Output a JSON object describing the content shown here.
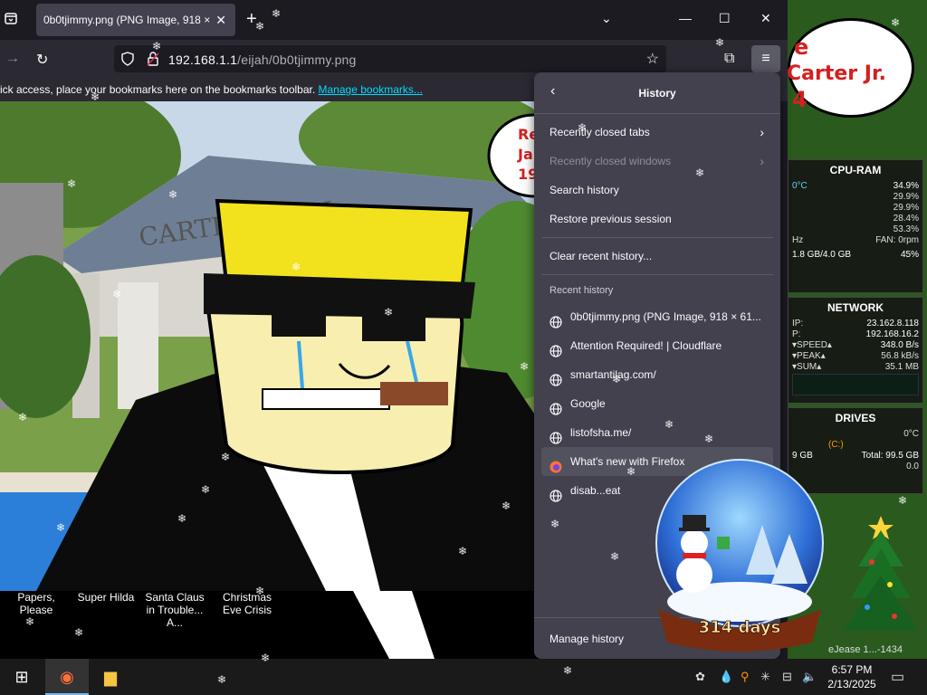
{
  "tab": {
    "title": "0b0tjimmy.png (PNG Image, 918 ×",
    "close_glyph": "✕",
    "new_glyph": "+"
  },
  "window_controls": {
    "list_tabs": "⌄",
    "minimize": "—",
    "maximize": "☐",
    "close": "✕"
  },
  "navbar": {
    "forward": "→",
    "reload": "↻",
    "url_host": "192.168.1.1",
    "url_path": "/eijah/0b0tjimmy.png",
    "bookmark_star": "☆",
    "extensions": "⧉",
    "menu": "≡"
  },
  "bookmarks_bar": {
    "text": "ick access, place your bookmarks here on the bookmarks toolbar.",
    "link": "Manage bookmarks..."
  },
  "image_labels": [
    {
      "text": "Papers, Please"
    },
    {
      "text": "Super Hilda"
    },
    {
      "text": "Santa Claus in Trouble... A..."
    },
    {
      "text": "Christmas Eve Crisis"
    }
  ],
  "image_text": {
    "sign": "CARTER   NTIAL",
    "bubble_partial_lines": [
      "Re",
      "Ja",
      "19"
    ]
  },
  "history_panel": {
    "back": "‹",
    "title": "History",
    "actions": [
      {
        "label": "Recently closed tabs",
        "arrow": "›",
        "disabled": false
      },
      {
        "label": "Recently closed windows",
        "arrow": "›",
        "disabled": true
      },
      {
        "label": "Search history",
        "arrow": "",
        "disabled": false
      },
      {
        "label": "Restore previous session",
        "arrow": "",
        "disabled": false
      }
    ],
    "clear": "Clear recent history...",
    "recent_header": "Recent history",
    "recent": [
      {
        "label": "0b0tjimmy.png (PNG Image, 918 × 61...",
        "icon": "globe-icon"
      },
      {
        "label": "Attention Required! | Cloudflare",
        "icon": "globe-icon"
      },
      {
        "label": "smartantilag.com/",
        "icon": "globe-icon"
      },
      {
        "label": "Google",
        "icon": "globe-icon"
      },
      {
        "label": "listofsha.me/",
        "icon": "globe-icon"
      },
      {
        "label": "What's new with Firefox",
        "icon": "firefox-icon"
      },
      {
        "label": "disab...eat",
        "icon": "globe-icon"
      }
    ],
    "manage": "Manage history"
  },
  "desktop": {
    "bubble_lines": [
      "e",
      "Carter Jr.",
      "4"
    ]
  },
  "gadgets": {
    "cpu": {
      "title": "CPU-RAM",
      "temp": "0°C",
      "total": "34.9%",
      "cores": [
        "29.9%",
        "29.9%",
        "28.4%",
        "53.3%"
      ],
      "freq_label": "Hz",
      "fan_label": "FAN: 0rpm",
      "ram": "1.8 GB/4.0 GB",
      "ram_pct": "45%"
    },
    "network": {
      "title": "NETWORK",
      "ip_label": "IP:",
      "ip": "23.162.8.118",
      "lan_label": "P:",
      "lan": "192.168.16.2",
      "speed_label": "▾SPEED▴",
      "speed": "348.0 B/s",
      "peak_label": "▾PEAK▴",
      "peak": "56.8 kB/s",
      "sum_label": "▾SUM▴",
      "sum": "35.1 MB"
    },
    "drives": {
      "title": "DRIVES",
      "temp": "0°C",
      "drive": "(C:)",
      "used": "9 GB",
      "total": "Total: 99.5 GB",
      "other": "0.0"
    }
  },
  "snowglobe": {
    "days": "314 days"
  },
  "release_text": "eJease 1...-1434",
  "taskbar": {
    "start": "⊞",
    "firefox": "◉",
    "explorer": "▆",
    "clock_time": "6:57 PM",
    "clock_date": "2/13/2025",
    "notifications": "▭"
  },
  "colors": {
    "accent_link": "#00ddff",
    "panel_bg": "#42414d",
    "toolbar_bg": "#2b2a33",
    "tab_bg": "#1c1b22"
  }
}
